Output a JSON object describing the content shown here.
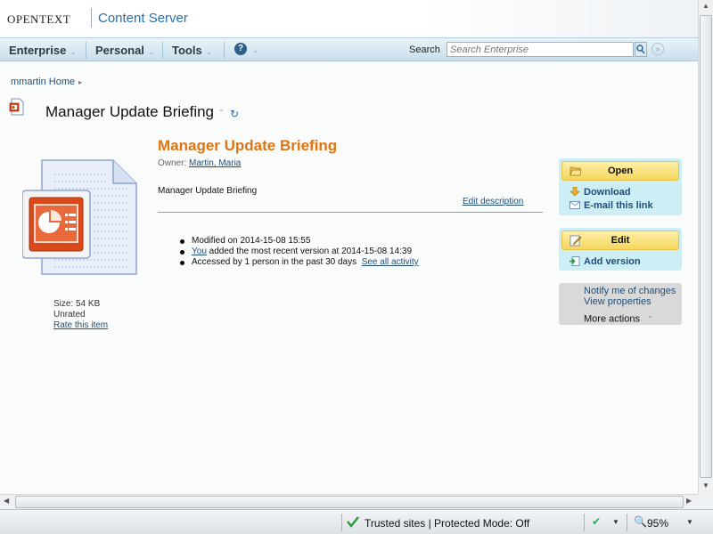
{
  "header": {
    "brand_open": "OPEN",
    "brand_text": "TEXT",
    "product": "Content Server"
  },
  "nav": {
    "items": [
      {
        "label": "Enterprise"
      },
      {
        "label": "Personal"
      },
      {
        "label": "Tools"
      }
    ],
    "help_icon": "?",
    "search_label": "Search",
    "search_placeholder": "Search Enterprise"
  },
  "breadcrumb": {
    "label": "mmartin Home"
  },
  "page_title": "Manager Update Briefing",
  "document": {
    "heading": "Manager Update Briefing",
    "owner_label": "Owner:",
    "owner_name": "Martin, Maria",
    "description": "Manager Update Briefing",
    "edit_description": "Edit description",
    "size_label": "Size:",
    "size_value": "54 KB",
    "rating": "Unrated",
    "rate_link": "Rate this item"
  },
  "activity": {
    "modified": "Modified on 2014-15-08 15:55",
    "you_link": "You",
    "version_text": "added the most recent version at 2014-15-08 14:39",
    "accessed": "Accessed by 1 person in the past 30 days",
    "see_all": "See all activity"
  },
  "actions": {
    "open": "Open",
    "download": "Download",
    "email": "E-mail this link",
    "edit": "Edit",
    "add_version": "Add version",
    "notify": "Notify me of changes",
    "view_properties": "View properties",
    "more_actions": "More actions"
  },
  "statusbar": {
    "zone": "Trusted sites | Protected Mode: Off",
    "zoom": "95%"
  },
  "colors": {
    "accent_orange": "#e07410",
    "link_blue": "#1f4e79",
    "button_yellow": "#f6d65c",
    "panel_cyan": "#cdeef5"
  }
}
